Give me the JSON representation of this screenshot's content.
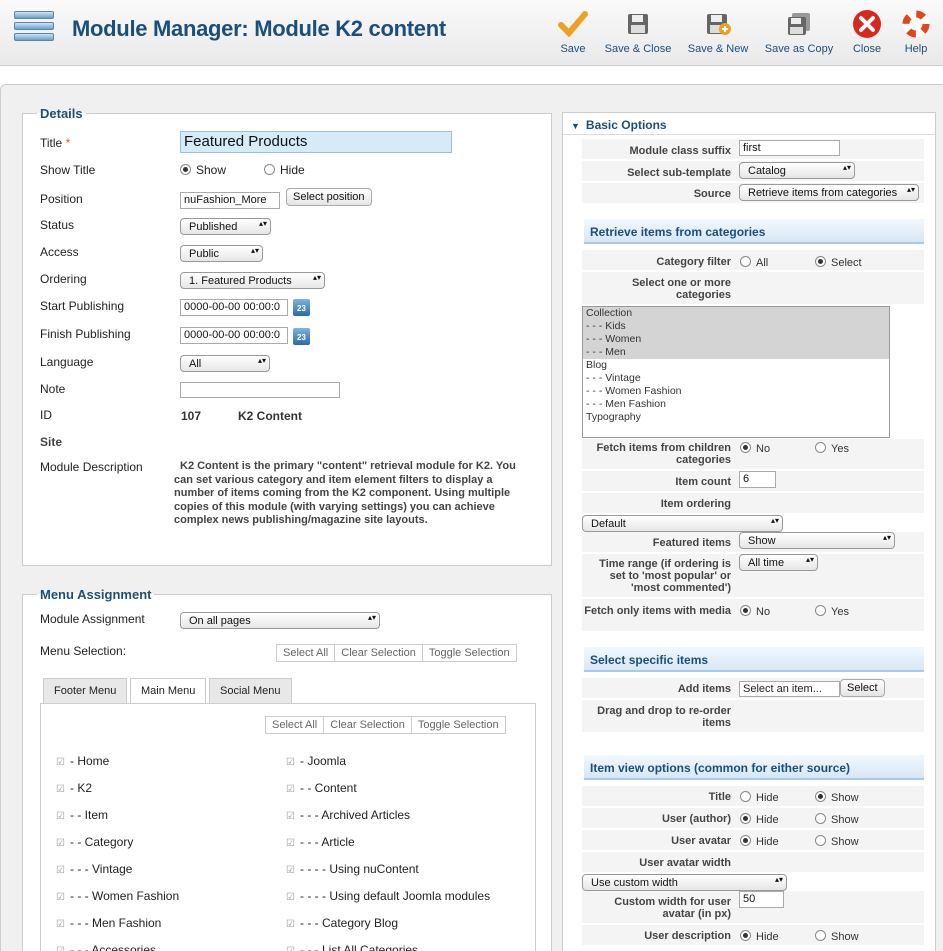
{
  "header": {
    "title": "Module Manager: Module K2 content",
    "toolbar": [
      {
        "id": "save",
        "label": "Save",
        "icon": "checkmark-icon"
      },
      {
        "id": "save-close",
        "label": "Save & Close",
        "icon": "floppy-icon"
      },
      {
        "id": "save-new",
        "label": "Save & New",
        "icon": "floppy-plus-icon"
      },
      {
        "id": "save-copy",
        "label": "Save as Copy",
        "icon": "floppy-copy-icon"
      },
      {
        "id": "close",
        "label": "Close",
        "icon": "close-icon"
      },
      {
        "id": "help",
        "label": "Help",
        "icon": "lifebuoy-icon"
      }
    ]
  },
  "details": {
    "legend": "Details",
    "title_label": "Title",
    "required": "*",
    "title_value": "Featured Products",
    "show_title_label": "Show Title",
    "show_opt": "Show",
    "hide_opt": "Hide",
    "position_label": "Position",
    "position_value": "nuFashion_More",
    "select_position": "Select position",
    "status_label": "Status",
    "status_value": "Published",
    "access_label": "Access",
    "access_value": "Public",
    "ordering_label": "Ordering",
    "ordering_value": "1. Featured Products",
    "start_label": "Start Publishing",
    "start_value": "0000-00-00 00:00:0",
    "finish_label": "Finish Publishing",
    "finish_value": "0000-00-00 00:00:0",
    "cal_text": "23",
    "language_label": "Language",
    "language_value": "All",
    "note_label": "Note",
    "note_value": "",
    "id_label": "ID",
    "id_value": "107",
    "id_type": "K2 Content",
    "site_label": "Site",
    "desc_label": "Module Description",
    "desc_text": "K2 Content is the primary \"content\" retrieval module for K2. You can set various category and item element filters to display a number of items coming from the K2 component. Using multiple copies of this module (with varying settings) you can achieve complex news publishing/magazine site layouts."
  },
  "menu": {
    "legend": "Menu Assignment",
    "assign_label": "Module Assignment",
    "assign_value": "On all pages",
    "selection_label": "Menu Selection:",
    "buttons": [
      "Select All",
      "Clear Selection",
      "Toggle Selection"
    ],
    "tabs": [
      "Footer Menu",
      "Main Menu",
      "Social Menu"
    ],
    "left_items": [
      "- Home",
      "- K2",
      "- - Item",
      "- - Category",
      "- - - Vintage",
      "- - - Women Fashion",
      "- - - Men Fashion",
      "- - - Accessories"
    ],
    "right_items": [
      "- Joomla",
      "- - Content",
      "- - - Archived Articles",
      "- - - Article",
      "- - - - Using nuContent",
      "- - - - Using default Joomla modules",
      "- - - Category Blog",
      "- - - List All Categories"
    ]
  },
  "basic": {
    "header": "Basic Options",
    "suffix_label": "Module class suffix",
    "suffix_value": "first",
    "subtpl_label": "Select sub-template",
    "subtpl_value": "Catalog",
    "source_label": "Source",
    "source_value": "Retrieve items from categories",
    "retrieve_header": "Retrieve items from categories",
    "catfilter_label": "Category filter",
    "all_opt": "All",
    "select_opt": "Select",
    "selectcat_label": "Select one or more categories",
    "categories": [
      "Collection",
      "- - - Kids",
      "- - - Women",
      "- - - Men",
      "Blog",
      "- - - Vintage",
      "- - - Women Fashion",
      "- - - Men Fashion",
      "Typography"
    ],
    "children_label": "Fetch items from children categories",
    "no_opt": "No",
    "yes_opt": "Yes",
    "count_label": "Item count",
    "count_value": "6",
    "ordering_label": "Item ordering",
    "ordering_value": "Default",
    "featured_label": "Featured items",
    "featured_value": "Show",
    "timerange_label": "Time range (if ordering is set to 'most popular' or 'most commented')",
    "timerange_value": "All time",
    "media_label": "Fetch only items with media",
    "specific_header": "Select specific items",
    "add_label": "Add items",
    "add_placeholder": "Select an item...",
    "add_button": "Select",
    "drag_label": "Drag and drop to re-order items",
    "view_header": "Item view options (common for either source)",
    "title_label": "Title",
    "hide_opt": "Hide",
    "show_opt": "Show",
    "author_label": "User (author)",
    "avatar_label": "User avatar",
    "avwidth_label": "User avatar width",
    "avwidth_value": "Use custom width",
    "customw_label": "Custom width for user avatar (in px)",
    "customw_value": "50",
    "udesc_label": "User description"
  }
}
